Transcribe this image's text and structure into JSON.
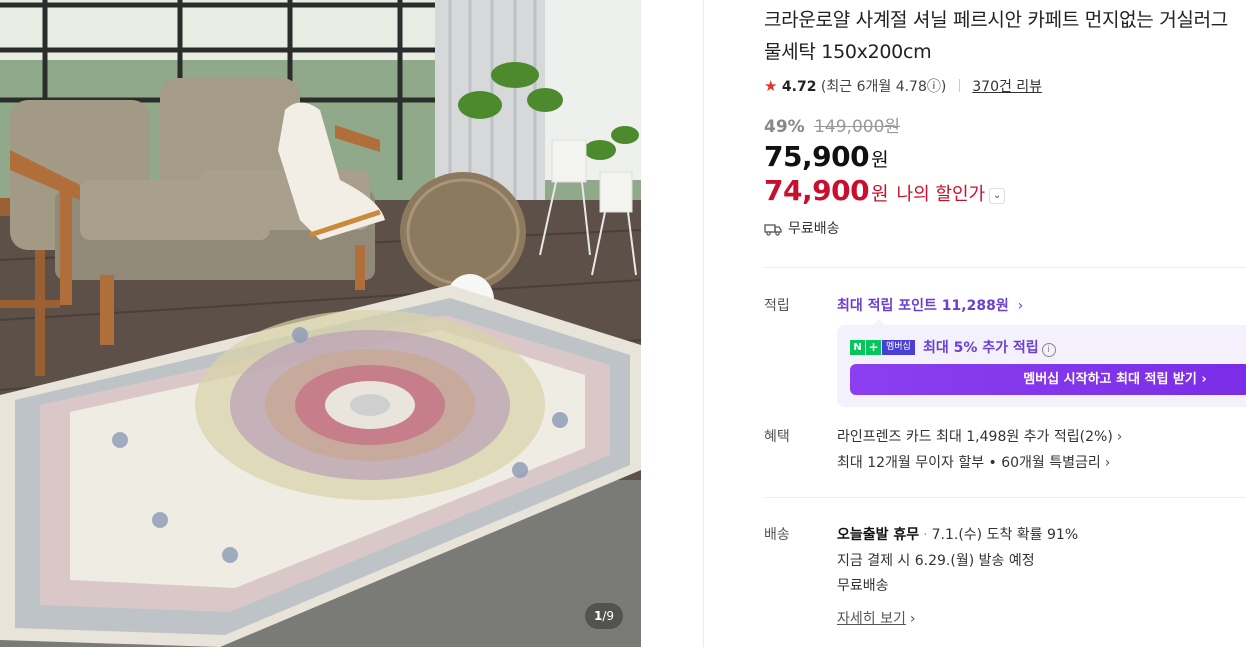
{
  "gallery": {
    "current": "1",
    "separator": "/",
    "total": "9"
  },
  "product": {
    "title": "크라운로얄 사계절 셔닐 페르시안 카페트 먼지없는 거실러그 물세탁 150x200cm",
    "rating_star": "★",
    "rating": "4.72",
    "rating_recent": "(최근 6개월 4.78ⓘ)",
    "review_count": "370건 리뷰",
    "discount_pct": "49%",
    "original_price": "149,000원",
    "price_num": "75,900",
    "price_won": "원",
    "my_price_num": "74,900",
    "my_price_won": "원",
    "my_price_label": "나의 할인가",
    "shipping_free": "무료배송"
  },
  "points": {
    "label": "적립",
    "max_text": "최대 적립 포인트",
    "max_amount": "11,288원",
    "badge_n": "N",
    "badge_plus": "+",
    "badge_member": "멤버십",
    "member_text": "최대 5% 추가 적립",
    "member_button": "멤버십 시작하고 최대 적립 받기 ›"
  },
  "benefits": {
    "label": "혜택",
    "line1": "라인프렌즈 카드 최대 1,498원 추가 적립(2%)",
    "line2": "최대 12개월 무이자 할부 • 60개월 특별금리"
  },
  "delivery": {
    "label": "배송",
    "today": "오늘출발 휴무",
    "arrival": "7.1.(수) 도착 확률 91%",
    "payment": "지금 결제 시 6.29.(월) 발송 예정",
    "free": "무료배송",
    "detail": "자세히 보기"
  },
  "colors": {
    "accent_red": "#c8102e",
    "accent_purple": "#6a3fd4",
    "naver_green": "#03c75a"
  }
}
